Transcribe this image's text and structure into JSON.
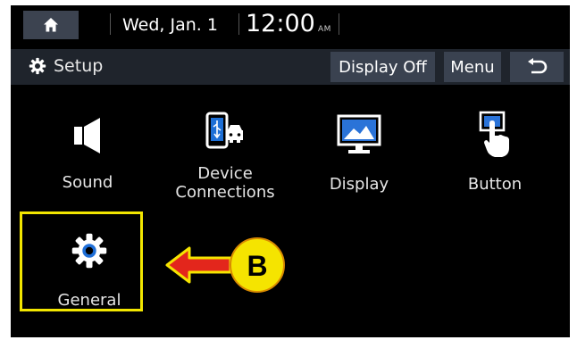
{
  "status_bar": {
    "date": "Wed, Jan. 1",
    "time": "12:00",
    "ampm": "AM",
    "home_icon": "home-icon"
  },
  "header": {
    "title": "Setup",
    "title_icon": "gear-icon",
    "buttons": {
      "display_off": "Display Off",
      "menu": "Menu",
      "back_icon": "back-arrow-icon"
    }
  },
  "menu": {
    "items": [
      {
        "label": "Sound",
        "icon": "speaker-icon"
      },
      {
        "label": "Device\nConnections",
        "icon": "phone-car-icon"
      },
      {
        "label": "Display",
        "icon": "monitor-icon"
      },
      {
        "label": "Button",
        "icon": "hand-touch-icon"
      },
      {
        "label": "General",
        "icon": "gear-icon"
      }
    ]
  },
  "annotation": {
    "letter": "B",
    "arrow_color": "#e3261c",
    "callout_color": "#f5e400",
    "highlight_color": "#f2e600"
  }
}
